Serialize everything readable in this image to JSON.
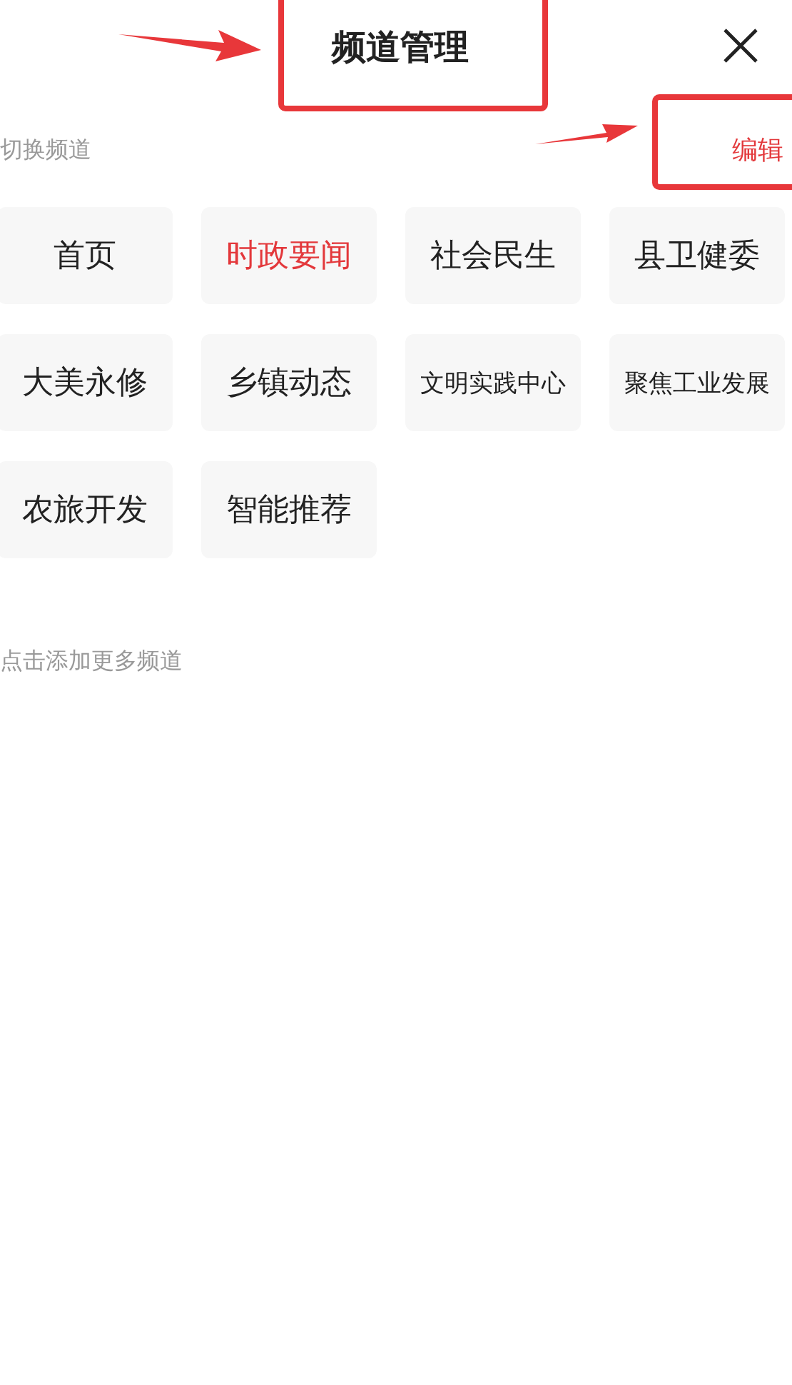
{
  "header": {
    "title": "频道管理"
  },
  "section": {
    "label": "切换频道",
    "edit_button": "编辑"
  },
  "channels": [
    {
      "label": "首页",
      "selected": false
    },
    {
      "label": "时政要闻",
      "selected": true
    },
    {
      "label": "社会民生",
      "selected": false
    },
    {
      "label": "县卫健委",
      "selected": false
    },
    {
      "label": "大美永修",
      "selected": false
    },
    {
      "label": "乡镇动态",
      "selected": false
    },
    {
      "label": "文明实践中心",
      "selected": false
    },
    {
      "label": "聚焦工业发展",
      "selected": false
    },
    {
      "label": "农旅开发",
      "selected": false
    },
    {
      "label": "智能推荐",
      "selected": false
    }
  ],
  "more": {
    "label": "点击添加更多频道"
  }
}
